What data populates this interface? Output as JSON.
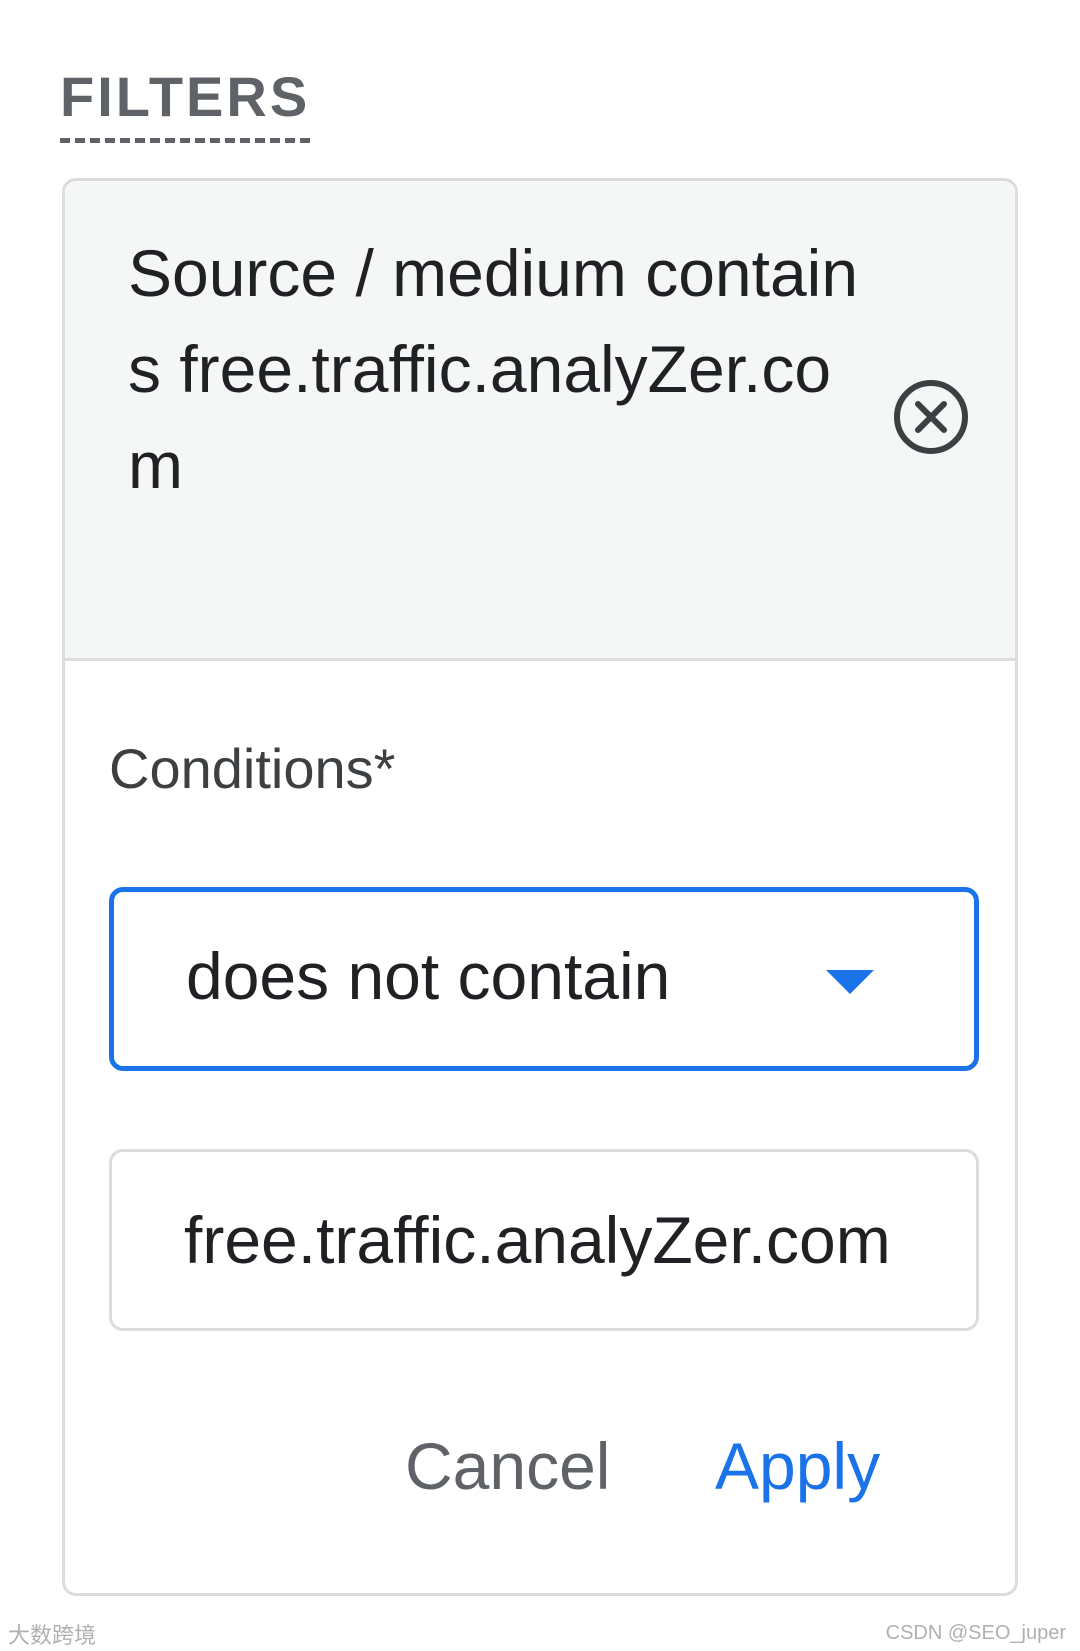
{
  "filters": {
    "heading": "FILTERS"
  },
  "chip": {
    "text": "Source / medium contains free.traffic.analyZer.com",
    "close_icon": "close-circle-icon"
  },
  "conditions": {
    "label": "Conditions*",
    "operator_value": "does not contain",
    "dropdown_icon": "dropdown-arrow-icon",
    "value_input": "free.traffic.analyZer.com"
  },
  "actions": {
    "cancel_label": "Cancel",
    "apply_label": "Apply"
  },
  "watermarks": {
    "left": "大数跨境",
    "right": "CSDN @SEO_juper"
  },
  "colors": {
    "accent": "#1a73e8",
    "text": "#202124",
    "muted": "#5f6368",
    "border": "#dadce0",
    "chip_bg": "#f5f6f6"
  }
}
